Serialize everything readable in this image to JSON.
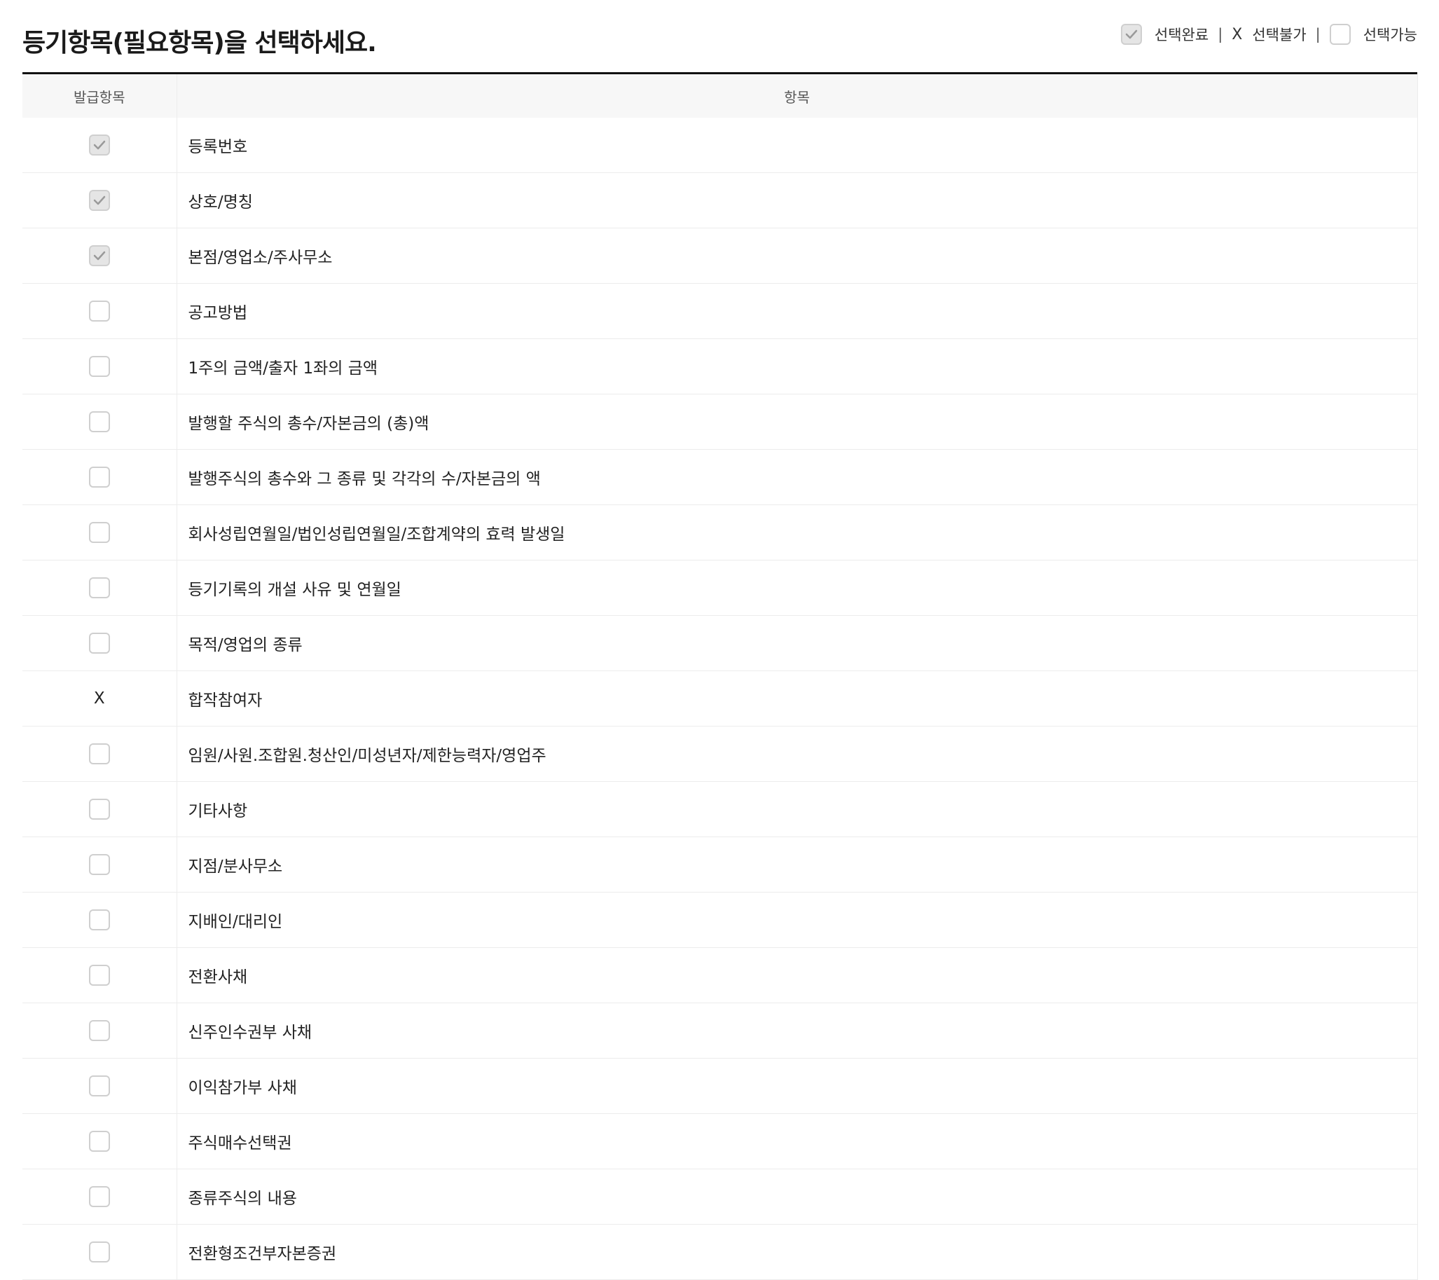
{
  "header": {
    "title": "등기항목(필요항목)을 선택하세요."
  },
  "legend": {
    "completed_label": "선택완료",
    "separator": "|",
    "unavailable_mark": "X",
    "unavailable_label": "선택불가",
    "available_label": "선택가능"
  },
  "table": {
    "columns": [
      "발급항목",
      "항목"
    ],
    "rows": [
      {
        "state": "checked",
        "label": "등록번호"
      },
      {
        "state": "checked",
        "label": "상호/명칭"
      },
      {
        "state": "checked",
        "label": "본점/영업소/주사무소"
      },
      {
        "state": "available",
        "label": "공고방법"
      },
      {
        "state": "available",
        "label": "1주의 금액/출자 1좌의 금액"
      },
      {
        "state": "available",
        "label": "발행할 주식의 총수/자본금의 (총)액"
      },
      {
        "state": "available",
        "label": "발행주식의 총수와 그 종류 및 각각의 수/자본금의 액"
      },
      {
        "state": "available",
        "label": "회사성립연월일/법인성립연월일/조합계약의 효력 발생일"
      },
      {
        "state": "available",
        "label": "등기기록의 개설 사유 및 연월일"
      },
      {
        "state": "available",
        "label": "목적/영업의 종류"
      },
      {
        "state": "unavailable",
        "mark": "X",
        "label": "합작참여자"
      },
      {
        "state": "available",
        "label": "임원/사원.조합원.청산인/미성년자/제한능력자/영업주"
      },
      {
        "state": "available",
        "label": "기타사항"
      },
      {
        "state": "available",
        "label": "지점/분사무소"
      },
      {
        "state": "available",
        "label": "지배인/대리인"
      },
      {
        "state": "available",
        "label": "전환사채"
      },
      {
        "state": "available",
        "label": "신주인수권부 사채"
      },
      {
        "state": "available",
        "label": "이익참가부 사채"
      },
      {
        "state": "available",
        "label": "주식매수선택권"
      },
      {
        "state": "available",
        "label": "종류주식의 내용"
      },
      {
        "state": "available",
        "label": "전환형조건부자본증권"
      }
    ]
  },
  "colors": {
    "checked_fill": "#e5e5e5",
    "checkbox_border": "#cfcfcf",
    "check_mark": "#9a9a9a",
    "header_bg": "#f7f7f7",
    "title_rule": "#111111"
  }
}
